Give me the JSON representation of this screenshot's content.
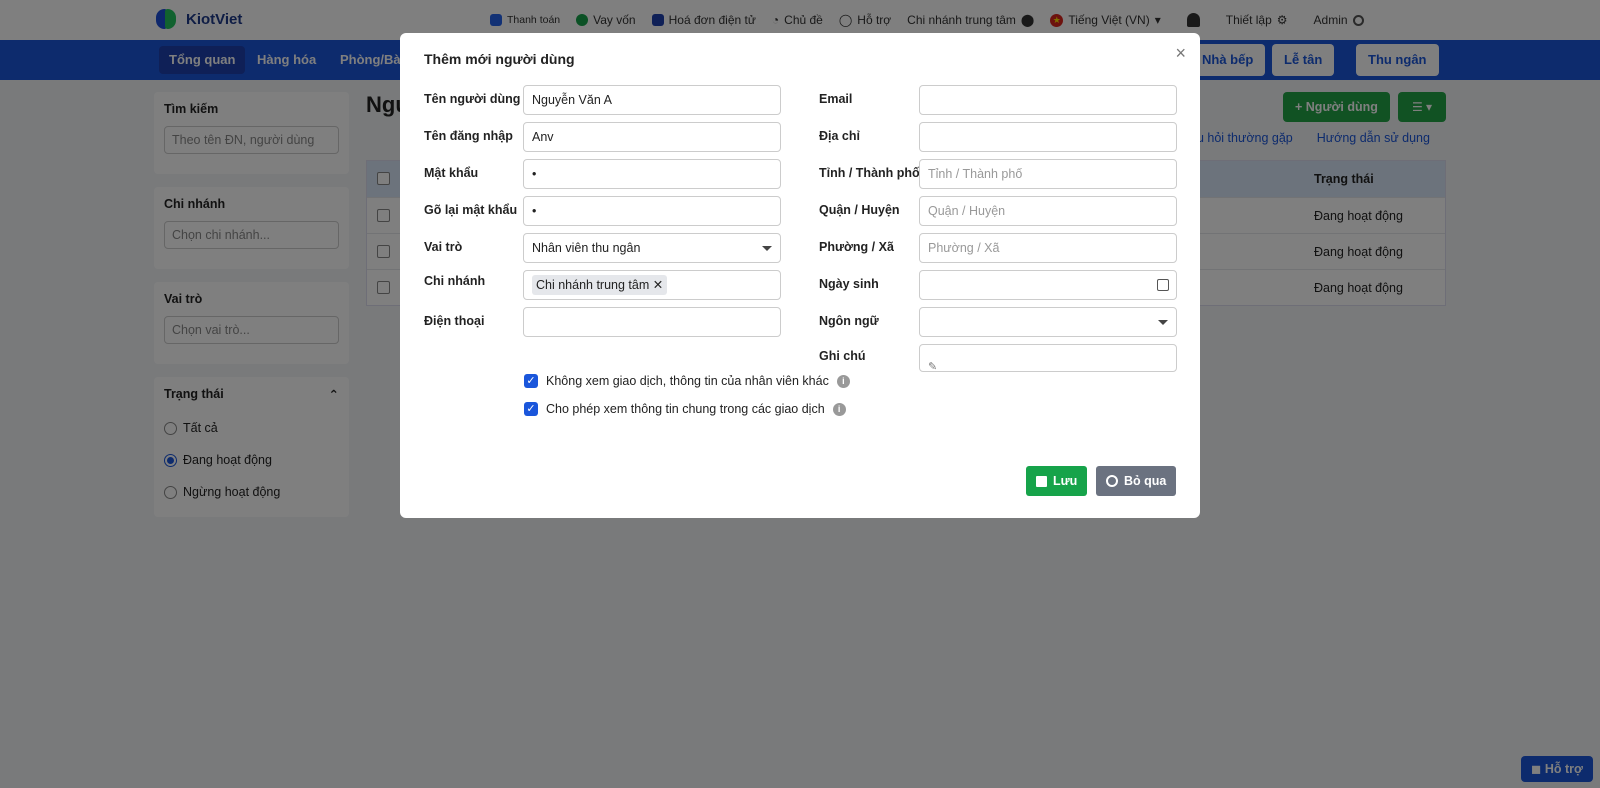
{
  "brand": {
    "name": "KiotViet"
  },
  "topnav": {
    "payment": "Thanh toán",
    "loan": "Vay vốn",
    "einvoice": "Hoá đơn điện tử",
    "theme": "Chủ đề",
    "support": "Hỗ trợ",
    "branch": "Chi nhánh trung tâm",
    "language": "Tiếng Việt (VN)",
    "settings": "Thiết lập",
    "admin": "Admin"
  },
  "menu": {
    "items": [
      "Tổng quan",
      "Hàng hóa",
      "Phòng/Bàn"
    ],
    "buttons": [
      "Nhà bếp",
      "Lễ tân",
      "Thu ngân"
    ]
  },
  "sidebar": {
    "search": {
      "title": "Tìm kiếm",
      "placeholder": "Theo tên ĐN, người dùng"
    },
    "branch": {
      "title": "Chi nhánh",
      "placeholder": "Chọn chi nhánh..."
    },
    "role": {
      "title": "Vai trò",
      "placeholder": "Chọn vai trò..."
    },
    "status": {
      "title": "Trạng thái",
      "options": [
        "Tất cả",
        "Đang hoạt động",
        "Ngừng hoạt động"
      ],
      "selected": "Đang hoạt động"
    }
  },
  "main": {
    "title": "Ngư",
    "add_user": "Người dùng",
    "faq": "âu hỏi thường gặp",
    "guide": "Hướng dẫn sử dụng",
    "table": {
      "status_header": "Trạng thái",
      "rows": [
        "Đang hoạt động",
        "Đang hoạt động",
        "Đang hoạt động"
      ]
    }
  },
  "modal": {
    "title": "Thêm mới người dùng",
    "left": {
      "name": {
        "label": "Tên người dùng",
        "value": "Nguyễn Văn A"
      },
      "username": {
        "label": "Tên đăng nhập",
        "value": "Anv"
      },
      "password": {
        "label": "Mật khẩu",
        "value": "•"
      },
      "confirm": {
        "label": "Gõ lại mật khẩu",
        "value": "•"
      },
      "role": {
        "label": "Vai trò",
        "value": "Nhân viên thu ngân"
      },
      "branch": {
        "label": "Chi nhánh",
        "tag": "Chi nhánh trung tâm"
      },
      "phone": {
        "label": "Điện thoại",
        "value": ""
      }
    },
    "right": {
      "email": {
        "label": "Email",
        "value": ""
      },
      "address": {
        "label": "Địa chỉ",
        "value": ""
      },
      "province": {
        "label": "Tỉnh / Thành phố",
        "placeholder": "Tỉnh / Thành phố"
      },
      "district": {
        "label": "Quận / Huyện",
        "placeholder": "Quận / Huyện"
      },
      "ward": {
        "label": "Phường / Xã",
        "placeholder": "Phường / Xã"
      },
      "birthday": {
        "label": "Ngày sinh",
        "value": ""
      },
      "lang": {
        "label": "Ngôn ngữ",
        "value": ""
      },
      "note": {
        "label": "Ghi chú",
        "value": ""
      }
    },
    "checks": [
      "Không xem giao dịch, thông tin của nhân viên khác",
      "Cho phép xem thông tin chung trong các giao dịch"
    ],
    "save": "Lưu",
    "skip": "Bỏ qua"
  },
  "support_bubble": "Hỗ trợ",
  "colors": {
    "primary": "#1a56db",
    "success": "#16a34a",
    "muted": "#6b7280"
  }
}
